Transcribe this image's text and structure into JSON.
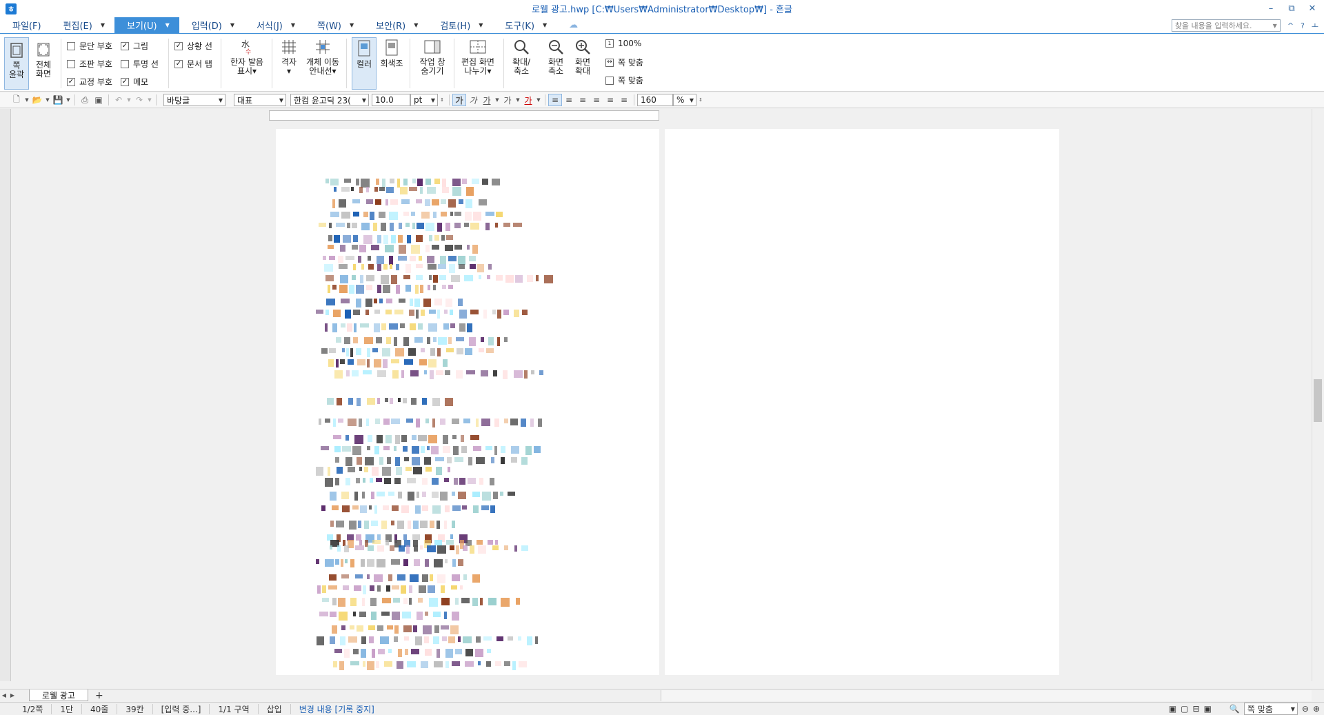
{
  "titlebar": {
    "title": "로웰 광고.hwp [C:₩Users₩Administrator₩Desktop₩] - 흔글",
    "minimize": "–",
    "restore": "⧉",
    "close": "✕"
  },
  "menubar": {
    "items": [
      {
        "label": "파일(F)"
      },
      {
        "label": "편집(E)"
      },
      {
        "label": "보기(U)"
      },
      {
        "label": "입력(D)"
      },
      {
        "label": "서식(J)"
      },
      {
        "label": "쪽(W)"
      },
      {
        "label": "보안(R)"
      },
      {
        "label": "검토(H)"
      },
      {
        "label": "도구(K)"
      }
    ],
    "search_placeholder": "찾을 내용을 입력하세요.",
    "collapse": "^",
    "help": "?",
    "pin": "ㅗ"
  },
  "ribbon": {
    "page_outline": "쪽\n윤곽",
    "full_screen": "전체\n화면",
    "checks": [
      {
        "label": "문단 부호",
        "checked": false
      },
      {
        "label": "그림",
        "checked": true
      },
      {
        "label": "조판 부호",
        "checked": false
      },
      {
        "label": "투명 선",
        "checked": false
      },
      {
        "label": "교정 부호",
        "checked": true
      },
      {
        "label": "메모",
        "checked": true
      },
      {
        "label": "상황 선",
        "checked": true
      },
      {
        "label": "문서 탭",
        "checked": true
      }
    ],
    "hanja": "한자 발음\n표시",
    "grid": "격자",
    "object_move": "개체 이동\n안내선",
    "color": "컬러",
    "grayscale": "회색조",
    "task_window": "작업 창\n숨기기",
    "split_view": "편집 화면\n나누기",
    "zoom_inout": "확대/\n축소",
    "zoom_out": "화면\n축소",
    "zoom_in": "화면\n확대",
    "zoom_100": "100%",
    "fit_page": "쪽 맞춤",
    "fit_width": "쪽 맞춤"
  },
  "toolbar": {
    "style": "바탕글",
    "outline": "대표",
    "font": "한컴 윤고딕 23(",
    "size": "10.0",
    "unit": "pt",
    "bold": "가",
    "italic": "가",
    "underline": "가",
    "strike": "가",
    "color": "가",
    "line_spacing": "160",
    "percent": "%"
  },
  "tabs": {
    "doc_tab": "로웰 광고",
    "add": "+"
  },
  "statusbar": {
    "page": "1/2쪽",
    "column": "1단",
    "line": "40줄",
    "char": "39칸",
    "input": "[입력 중...]",
    "section": "1/1 구역",
    "mode": "삽입",
    "track": "변경 내용 [기록 중지]",
    "zoom": "쪽 맞춤"
  }
}
